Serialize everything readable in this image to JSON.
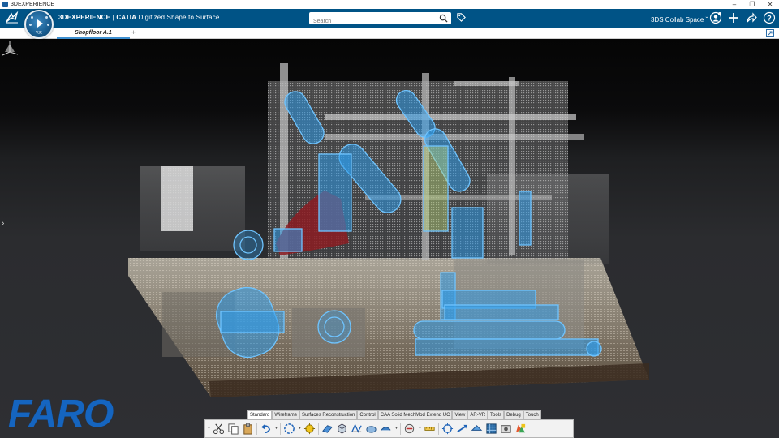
{
  "os_window": {
    "title": "3DEXPERIENCE",
    "controls": [
      "minimize-icon",
      "restore-icon",
      "close-icon"
    ]
  },
  "header": {
    "brand": "3DEXPERIENCE",
    "app_name": "CATIA",
    "app_subtitle": "Digitized Shape to Surface",
    "search_placeholder": "Search",
    "collab_space": "3DS Collab Space",
    "compass_version": "V.R",
    "icons": [
      "user-icon",
      "add-icon",
      "share-icon",
      "help-icon"
    ]
  },
  "tabs": {
    "items": [
      {
        "label": "Shopfloor A.1",
        "active": true
      }
    ],
    "add_label": "+"
  },
  "viewport": {
    "watermark": "FARO",
    "left_panel_arrow": "›",
    "content": "point-cloud-shopfloor-with-fitted-cylinders-and-boxes",
    "highlight_color": "#2f9be8"
  },
  "action_bar": {
    "tabs": [
      {
        "label": "Standard",
        "active": true
      },
      {
        "label": "Wireframe",
        "active": false
      },
      {
        "label": "Surfaces Reconstruction",
        "active": false
      },
      {
        "label": "Control",
        "active": false
      },
      {
        "label": "CAA Solid MechMod Extend UC",
        "active": false
      },
      {
        "label": "View",
        "active": false
      },
      {
        "label": "AR-VR",
        "active": false
      },
      {
        "label": "Tools",
        "active": false
      },
      {
        "label": "Debug",
        "active": false
      },
      {
        "label": "Touch",
        "active": false
      }
    ],
    "tools": [
      "cut-icon",
      "copy-icon",
      "paste-icon",
      "undo-icon",
      "redo-icon",
      "update-icon",
      "sketch-icon",
      "plane-icon",
      "box-icon",
      "mesh-icon",
      "cloud-icon",
      "fit-icon",
      "section-icon",
      "measure-icon",
      "analysis-icon",
      "align-icon",
      "grid-icon",
      "transform-icon",
      "capture-icon",
      "render-icon"
    ]
  },
  "colors": {
    "header_bg": "#005386",
    "tab_underline": "#3d8fd0",
    "faro_blue": "#1565c0"
  }
}
